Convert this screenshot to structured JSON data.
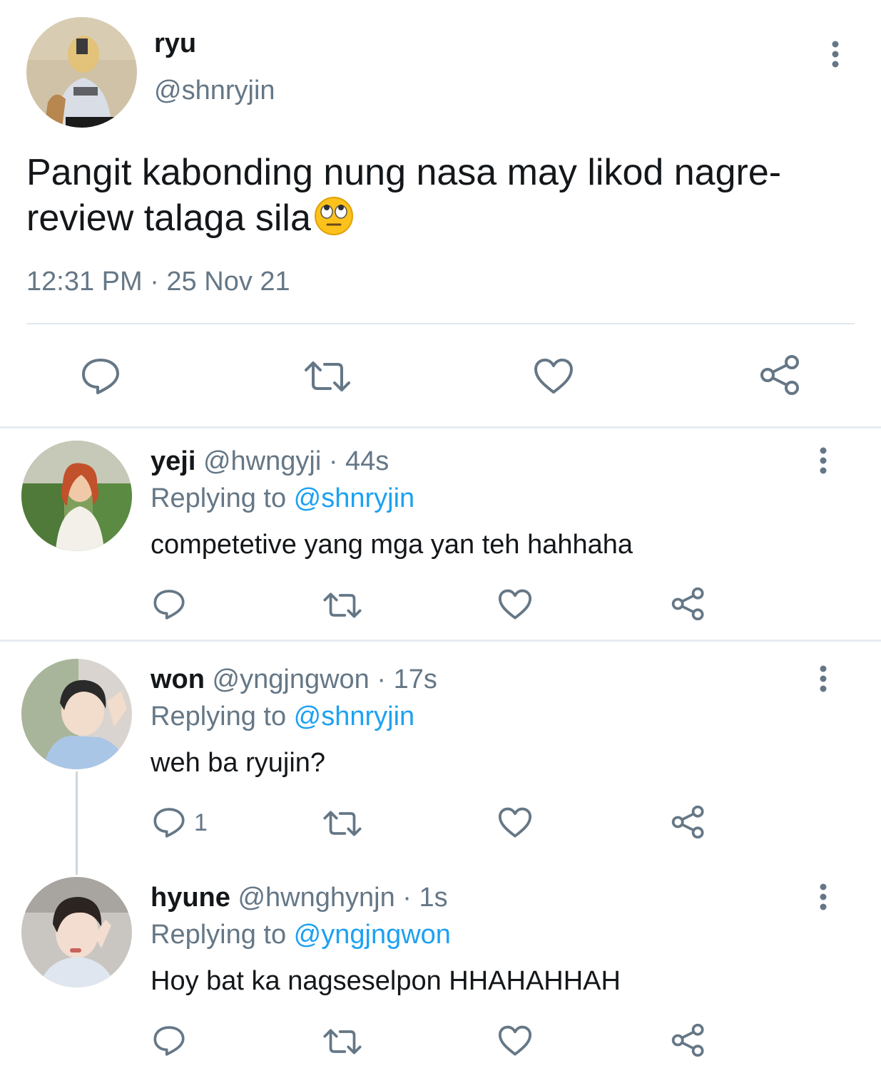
{
  "main_tweet": {
    "name": "ryu",
    "handle": "@shnryjin",
    "text": "Pangit kabonding nung nasa may likod nagre-review talaga sila",
    "emoji": "eye-roll-emoji",
    "timestamp": "12:31 PM · 25 Nov 21"
  },
  "replies": [
    {
      "name": "yeji",
      "handle": "@hwngyji · 44s",
      "replying_prefix": "Replying to ",
      "replying_to": "@shnryjin",
      "text": "competetive yang mga yan teh hahhaha",
      "reply_count": ""
    },
    {
      "name": "won",
      "handle": "@yngjngwon · 17s",
      "replying_prefix": "Replying to ",
      "replying_to": "@shnryjin",
      "text": "weh ba ryujin?",
      "reply_count": "1"
    },
    {
      "name": "hyune",
      "handle": "@hwnghynjn · 1s",
      "replying_prefix": "Replying to ",
      "replying_to": "@yngjngwon",
      "text": "Hoy bat ka nagseselpon HHAHAHHAH",
      "reply_count": ""
    }
  ],
  "colors": {
    "text": "#14171a",
    "secondary": "#657786",
    "link": "#1da1f2",
    "icon": "#657786",
    "divider": "#e6ecf0"
  }
}
